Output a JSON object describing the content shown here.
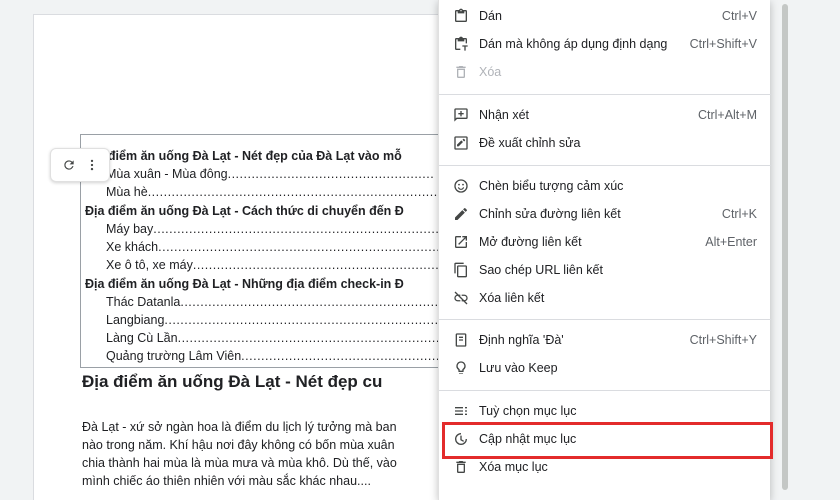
{
  "toc": {
    "entries": [
      {
        "level": 2,
        "text": "Địa điểm ăn uống Đà Lạt - Nét đẹp của Đà Lạt vào mỗ"
      },
      {
        "level": 3,
        "text": "Mùa xuân - Mùa đông",
        "dots": "...................................................."
      },
      {
        "level": 3,
        "text": "Mùa hè",
        "dots": "..................................................................................."
      },
      {
        "level": 2,
        "text": "Địa điểm ăn uống Đà Lạt - Cách thức di chuyển đến Đ"
      },
      {
        "level": 3,
        "text": "Máy bay",
        "dots": "................................................................................."
      },
      {
        "level": 3,
        "text": "Xe khách",
        "dots": "..............................................................................."
      },
      {
        "level": 3,
        "text": "Xe ô tô, xe máy",
        "dots": "........................................................................"
      },
      {
        "level": 2,
        "text": "Địa điểm ăn uống Đà Lạt - Những địa điểm check-in Đ"
      },
      {
        "level": 3,
        "text": "Thác Datanla",
        "dots": "......................................................................."
      },
      {
        "level": 3,
        "text": "Langbiang",
        "dots": ".............................................................................."
      },
      {
        "level": 3,
        "text": "Làng Cù Lần",
        "dots": "..........................................................................."
      },
      {
        "level": 3,
        "text": "Quảng trường Lâm Viên",
        "dots": "......................................................"
      }
    ]
  },
  "document": {
    "heading": "Địa điểm ăn uống Đà Lạt - Nét đẹp cu",
    "paragraph_lines": [
      "Đà Lạt - xứ sở ngàn hoa là điểm du lịch lý tưởng mà ban",
      "nào trong năm. Khí hậu nơi đây không có bốn mùa xuân",
      "chia thành hai mùa là mùa mưa và mùa khô. Dù thế, vào",
      "mình chiếc áo thiên nhiên với màu sắc khác nhau...."
    ]
  },
  "context_menu": {
    "items": [
      {
        "icon": "clipboard-icon",
        "label": "Dán",
        "shortcut": "Ctrl+V",
        "disabled": false
      },
      {
        "icon": "paste-no-format-icon",
        "label": "Dán mà không áp dụng định dạng",
        "shortcut": "Ctrl+Shift+V",
        "disabled": false
      },
      {
        "icon": "trash-icon",
        "label": "Xóa",
        "shortcut": "",
        "disabled": true
      },
      {
        "icon": "add-comment-icon",
        "label": "Nhận xét",
        "shortcut": "Ctrl+Alt+M",
        "disabled": false
      },
      {
        "icon": "suggest-edit-icon",
        "label": "Đề xuất chỉnh sửa",
        "shortcut": "",
        "disabled": false
      },
      {
        "icon": "emoji-icon",
        "label": "Chèn biểu tượng cảm xúc",
        "shortcut": "",
        "disabled": false
      },
      {
        "icon": "pencil-icon",
        "label": "Chỉnh sửa đường liên kết",
        "shortcut": "Ctrl+K",
        "disabled": false
      },
      {
        "icon": "open-link-icon",
        "label": "Mở đường liên kết",
        "shortcut": "Alt+Enter",
        "disabled": false
      },
      {
        "icon": "copy-icon",
        "label": "Sao chép URL liên kết",
        "shortcut": "",
        "disabled": false
      },
      {
        "icon": "unlink-icon",
        "label": "Xóa liên kết",
        "shortcut": "",
        "disabled": false
      },
      {
        "icon": "dictionary-icon",
        "label": "Định nghĩa 'Đà'",
        "shortcut": "Ctrl+Shift+Y",
        "disabled": false
      },
      {
        "icon": "keep-lightbulb-icon",
        "label": "Lưu vào Keep",
        "shortcut": "",
        "disabled": false
      },
      {
        "icon": "toc-options-icon",
        "label": "Tuỳ chọn mục lục",
        "shortcut": "",
        "disabled": false
      },
      {
        "icon": "update-toc-icon",
        "label": "Cập nhật mục lục",
        "shortcut": "",
        "disabled": false
      },
      {
        "icon": "trash-icon",
        "label": "Xóa mục lục",
        "shortcut": "",
        "disabled": false
      }
    ]
  },
  "colors": {
    "highlight": "#e32b2b",
    "icon": "#444746",
    "disabled": "#b0b3b8"
  }
}
